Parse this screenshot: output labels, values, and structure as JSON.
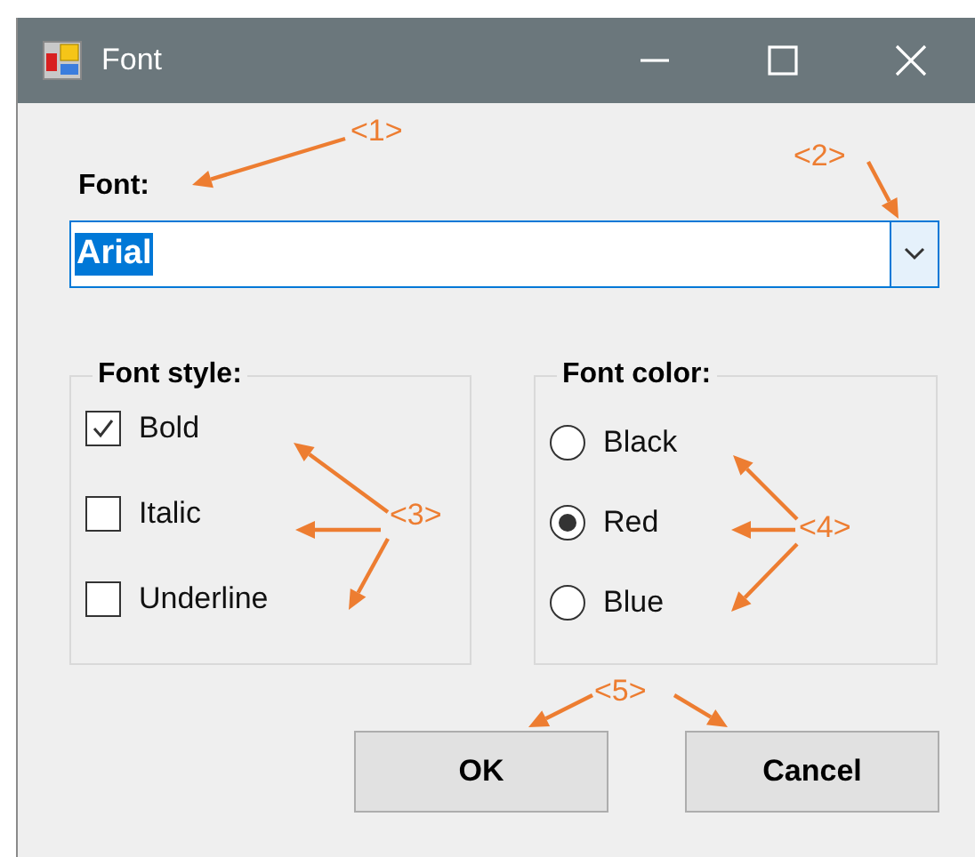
{
  "window": {
    "title": "Font"
  },
  "font_label": "Font:",
  "font_field": {
    "value": "Arial",
    "value_selected": true
  },
  "font_style": {
    "title": "Font style:",
    "options": [
      {
        "label": "Bold",
        "checked": true
      },
      {
        "label": "Italic",
        "checked": false
      },
      {
        "label": "Underline",
        "checked": false
      }
    ]
  },
  "font_color": {
    "title": "Font color:",
    "options": [
      {
        "label": "Black",
        "selected": false
      },
      {
        "label": "Red",
        "selected": true
      },
      {
        "label": "Blue",
        "selected": false
      }
    ]
  },
  "buttons": [
    {
      "label": "OK"
    },
    {
      "label": "Cancel"
    }
  ],
  "callouts": [
    {
      "label": "<1>"
    },
    {
      "label": "<2>"
    },
    {
      "label": "<3>"
    },
    {
      "label": "<4>"
    },
    {
      "label": "<5>"
    }
  ]
}
